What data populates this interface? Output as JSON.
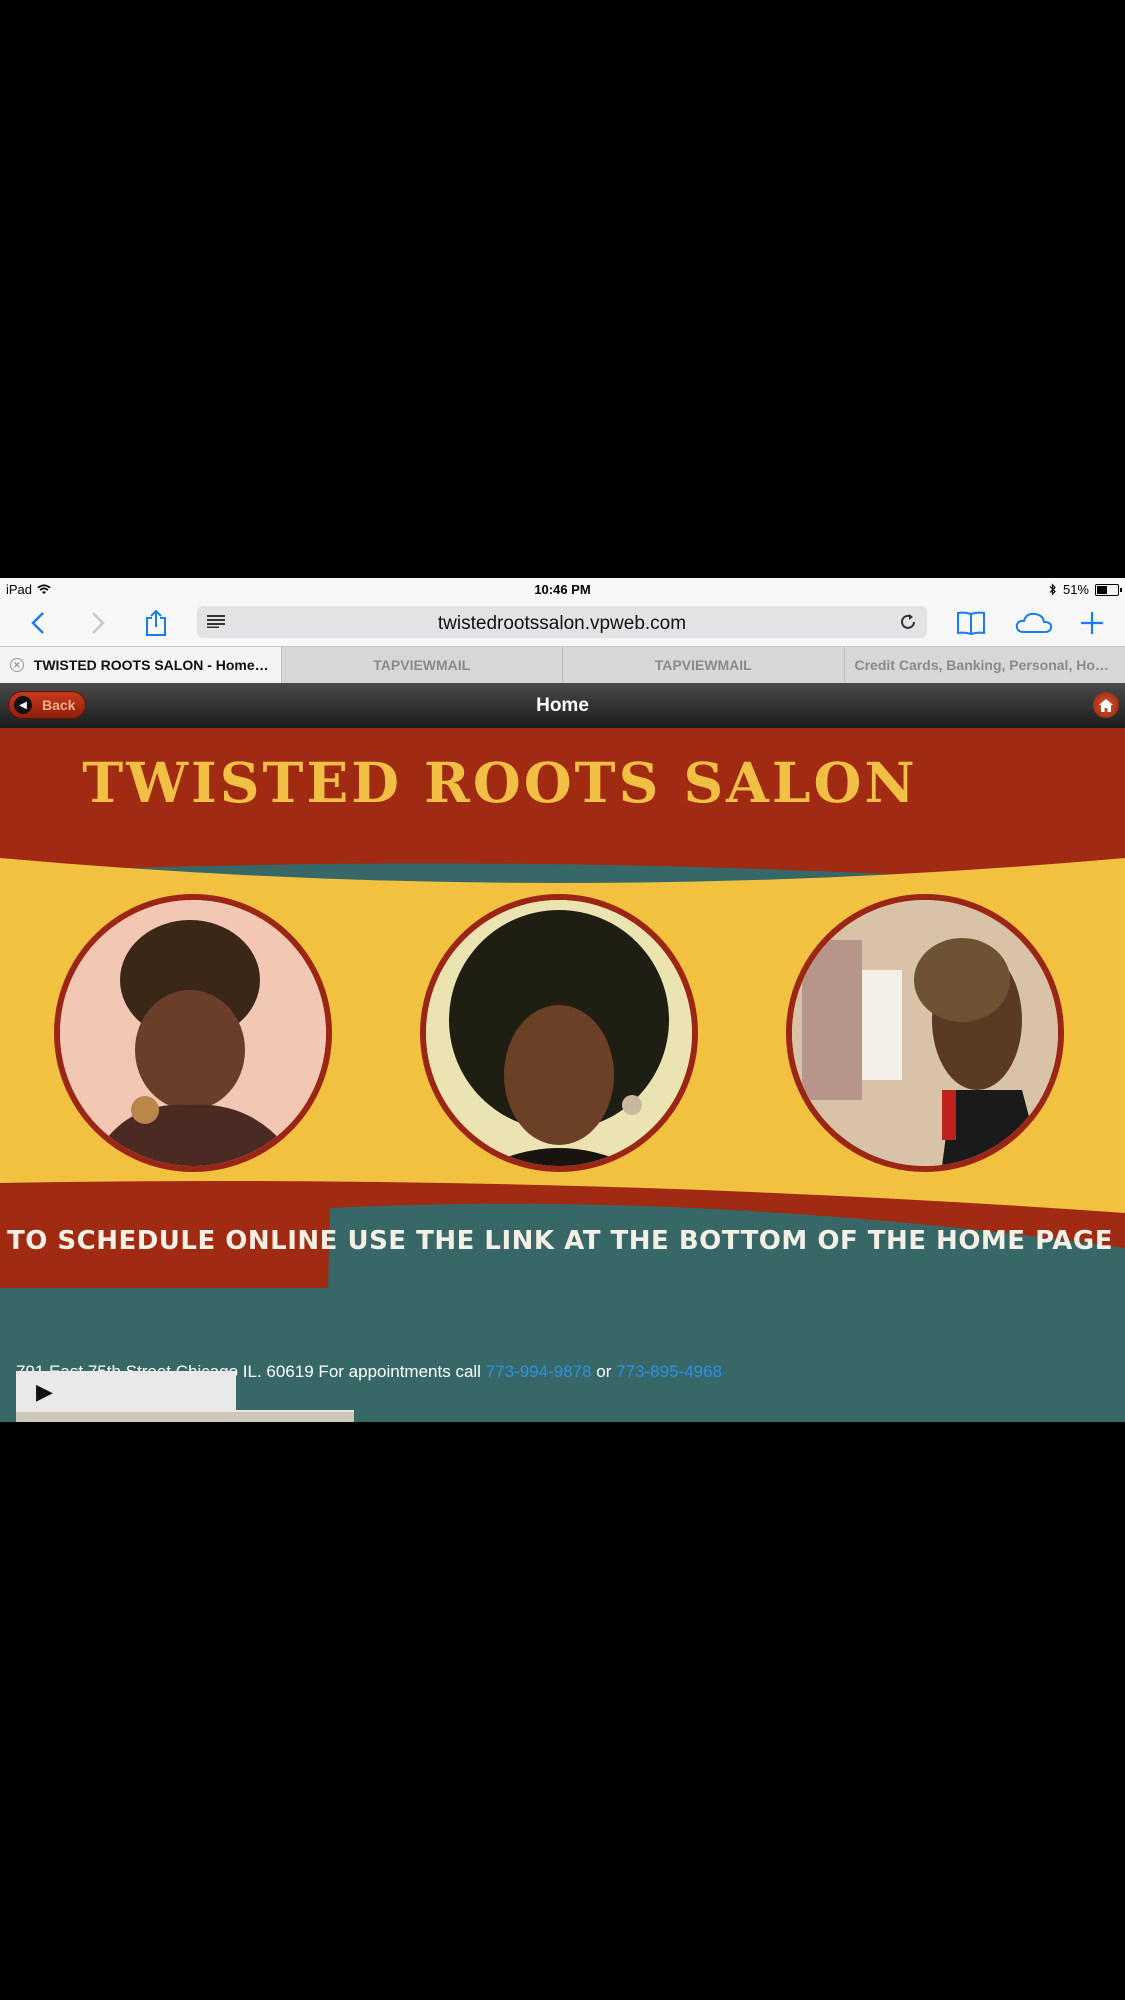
{
  "status_bar": {
    "device": "iPad",
    "time": "10:46 PM",
    "battery": "51%",
    "battery_level": 0.51
  },
  "toolbar": {
    "url": "twistedrootssalon.vpweb.com"
  },
  "tabs": [
    {
      "label": "TWISTED ROOTS SALON - Home -...",
      "active": true
    },
    {
      "label": "TAPVIEWMAIL",
      "active": false
    },
    {
      "label": "TAPVIEWMAIL",
      "active": false
    },
    {
      "label": "Credit Cards, Banking, Personal, Hom...",
      "active": false
    }
  ],
  "nav": {
    "back_label": "Back",
    "title": "Home"
  },
  "banner": {
    "title": "TWISTED ROOTS SALON",
    "schedule_text": "TO SCHEDULE ONLINE USE THE LINK AT THE BOTTOM OF THE HOME PAGE"
  },
  "address": {
    "text": "791 East 75th Street Chicago IL. 60619 For appointments call",
    "phone1": "773-994-9878",
    "or": "or",
    "phone2": "773-895-4968"
  },
  "colors": {
    "brand_red": "#9b2616",
    "brand_yellow": "#f1c13f",
    "brand_teal": "#376766",
    "link_blue": "#2d8fe8"
  }
}
